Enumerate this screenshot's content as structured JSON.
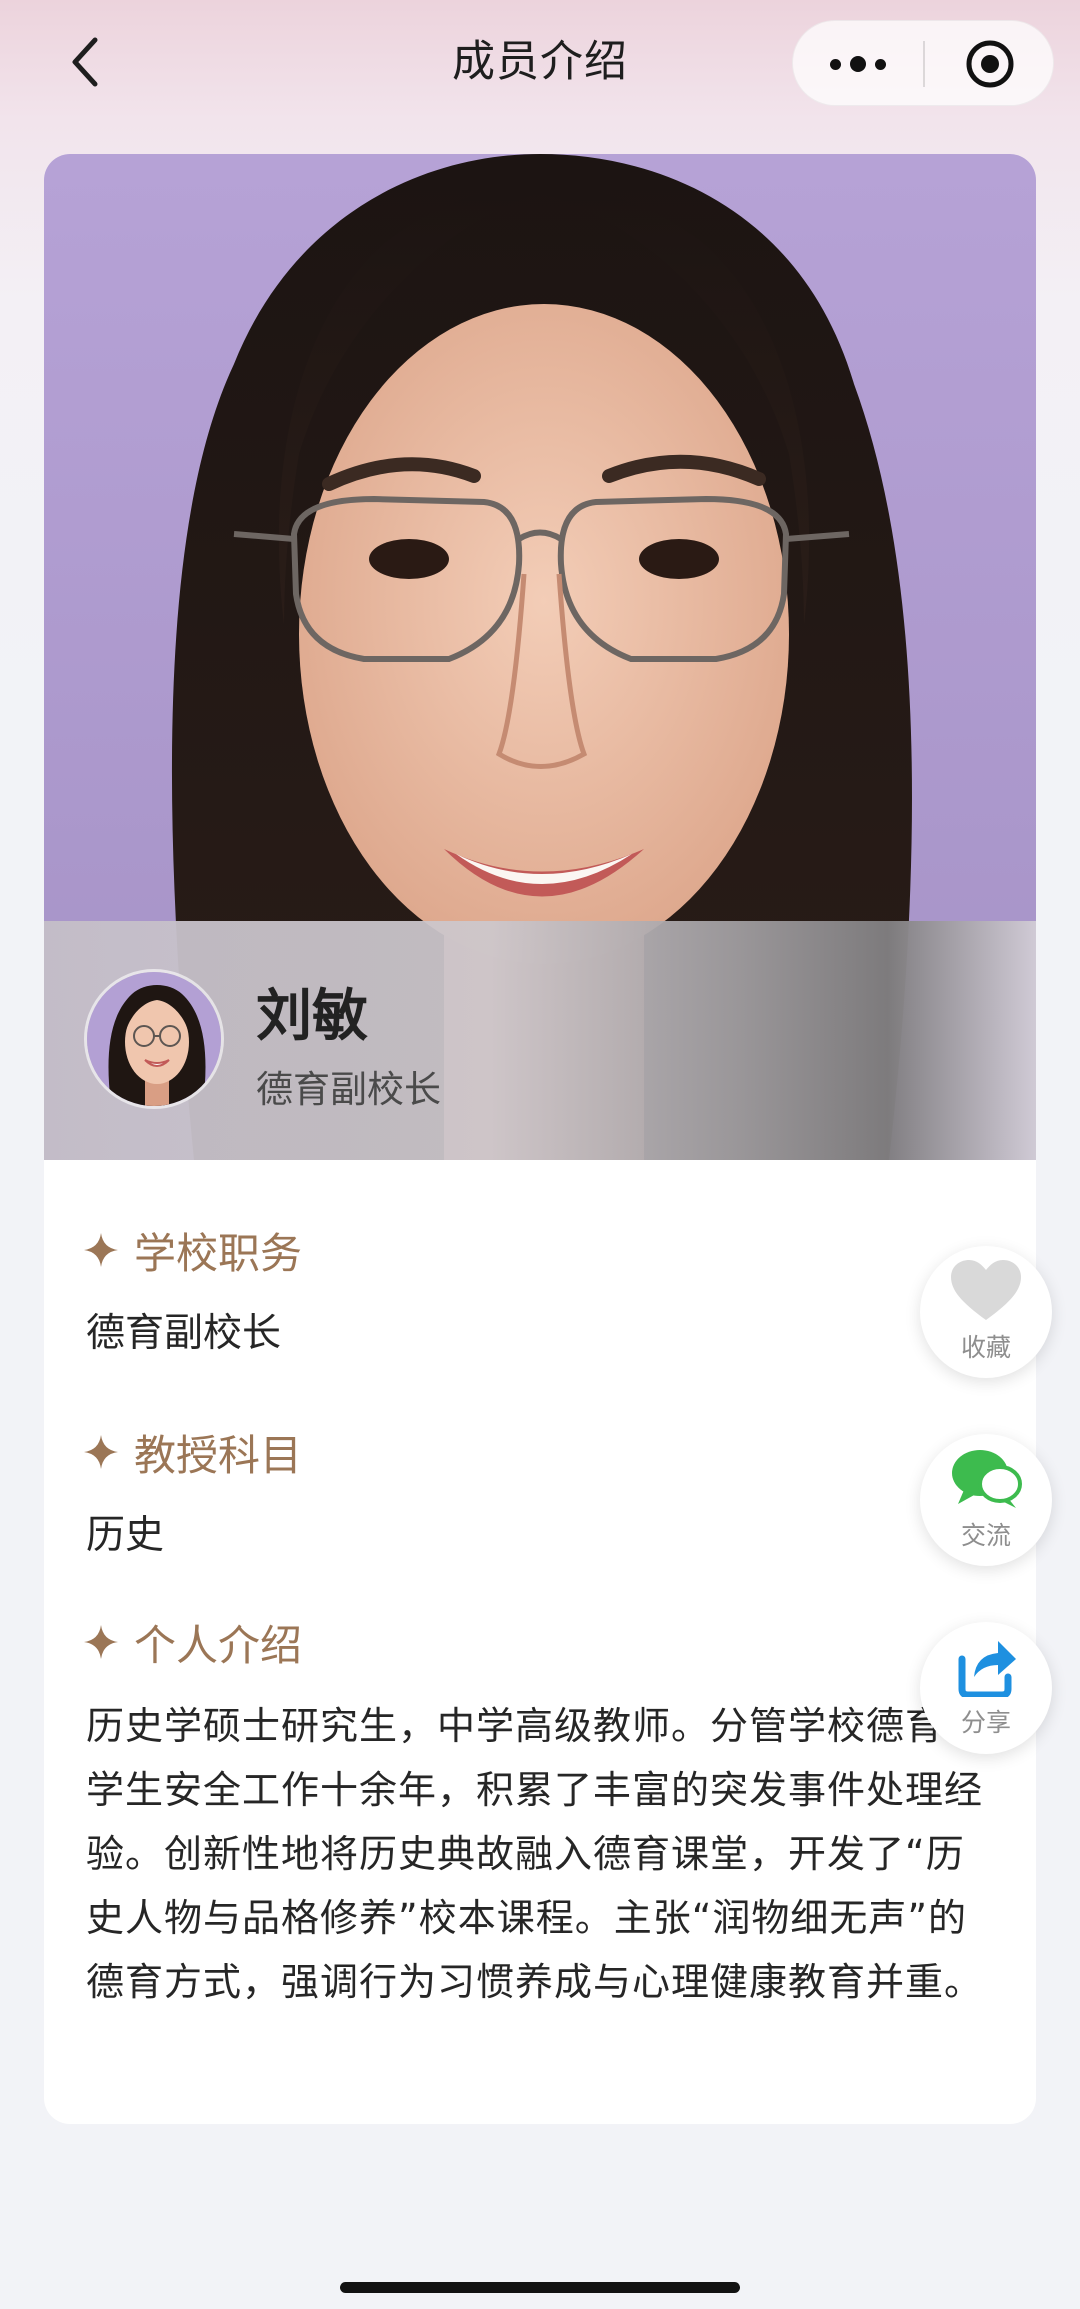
{
  "nav": {
    "title": "成员介绍"
  },
  "profile": {
    "name": "刘敏",
    "position": "德育副校长"
  },
  "sections": {
    "duty_title": "学校职务",
    "duty_value": "德育副校长",
    "subject_title": "教授科目",
    "subject_value": "历史",
    "intro_title": "个人介绍",
    "intro_text": "历史学硕士研究生，中学高级教师。分管学校德育与学生安全工作十余年，积累了丰富的突发事件处理经验。创新性地将历史典故融入德育课堂，开发了“历史人物与品格修养”校本课程。主张“润物细无声”的德育方式，强调行为习惯养成与心理健康教育并重。"
  },
  "actions": {
    "favorite": "收藏",
    "chat": "交流",
    "share": "分享"
  },
  "colors": {
    "accent": "#9b7656",
    "chat_green": "#3dbb4e",
    "share_blue": "#1e90e0",
    "favorite_gray": "#d9d9d9"
  },
  "icons": [
    "back-icon",
    "more-icon",
    "close-circle-icon",
    "sparkle-icon",
    "heart-icon",
    "chat-bubble-icon",
    "share-icon"
  ]
}
